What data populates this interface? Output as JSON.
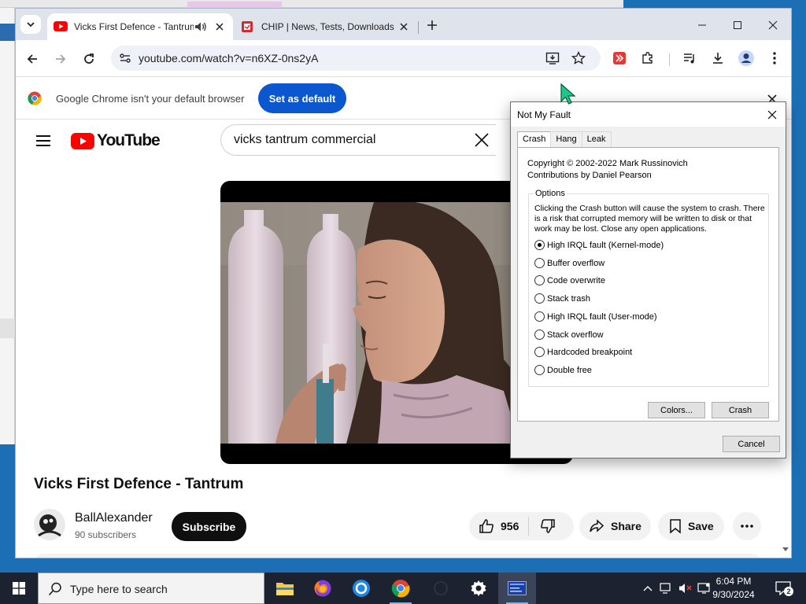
{
  "browser": {
    "tabs": [
      {
        "title": "Vicks First Defence - Tantrum",
        "active": true,
        "audio": true
      },
      {
        "title": "CHIP | News, Tests, Downloads",
        "active": false
      }
    ],
    "url": "youtube.com/watch?v=n6XZ-0ns2yA",
    "infobar": {
      "message": "Google Chrome isn't your default browser",
      "button": "Set as default"
    }
  },
  "youtube": {
    "wordmark": "YouTube",
    "search_value": "vicks tantrum commercial",
    "video_title": "Vicks First Defence - Tantrum",
    "channel_name": "BallAlexander",
    "subscribers": "90 subscribers",
    "subscribe_label": "Subscribe",
    "likes": "956",
    "share_label": "Share",
    "save_label": "Save"
  },
  "dialog": {
    "title": "Not My Fault",
    "tabs": [
      "Crash",
      "Hang",
      "Leak"
    ],
    "active_tab": "Crash",
    "copyright": "Copyright © 2002-2022 Mark Russinovich",
    "contributions": "Contributions by Daniel Pearson",
    "options_legend": "Options",
    "description": "Clicking the Crash button will cause the system to crash. There is a risk that corrupted memory will be written to disk or that work may be lost. Close any open applications.",
    "options": [
      {
        "label": "High IRQL fault (Kernel-mode)",
        "checked": true
      },
      {
        "label": "Buffer overflow",
        "checked": false
      },
      {
        "label": "Code overwrite",
        "checked": false
      },
      {
        "label": "Stack trash",
        "checked": false
      },
      {
        "label": "High IRQL fault (User-mode)",
        "checked": false
      },
      {
        "label": "Stack overflow",
        "checked": false
      },
      {
        "label": "Hardcoded breakpoint",
        "checked": false
      },
      {
        "label": "Double free",
        "checked": false
      }
    ],
    "colors_button": "Colors...",
    "crash_button": "Crash",
    "cancel_button": "Cancel"
  },
  "taskbar": {
    "search_placeholder": "Type here to search",
    "time": "6:04 PM",
    "date": "9/30/2024",
    "notification_count": "2"
  },
  "colors": {
    "youtube_red": "#ff0000",
    "chrome_blue": "#0b57d0",
    "taskbar_bg": "#1c2230"
  }
}
